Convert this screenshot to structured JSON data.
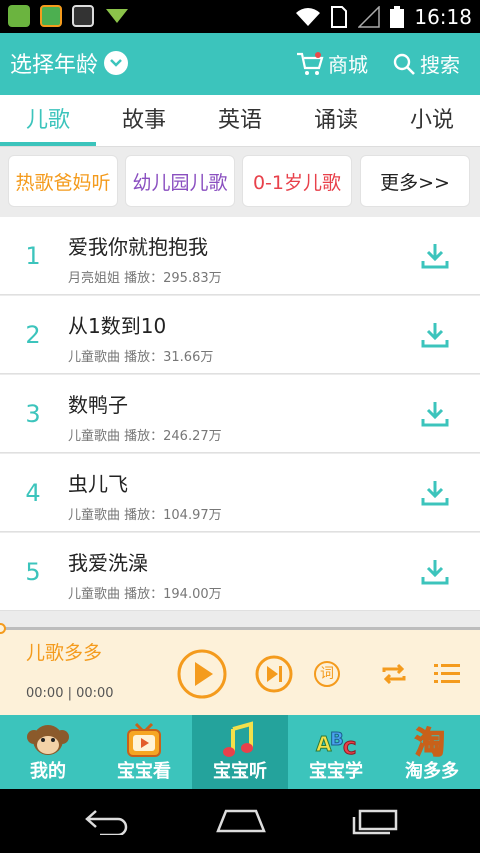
{
  "status_bar": {
    "time": "16:18"
  },
  "header": {
    "age_title": "选择年龄",
    "shop_label": "商城",
    "search_label": "搜索"
  },
  "tabs": [
    {
      "label": "儿歌",
      "active": true
    },
    {
      "label": "故事",
      "active": false
    },
    {
      "label": "英语",
      "active": false
    },
    {
      "label": "诵读",
      "active": false
    },
    {
      "label": "小说",
      "active": false
    }
  ],
  "chips": [
    "热歌爸妈听",
    "幼儿园儿歌",
    "0-1岁儿歌",
    "更多>>"
  ],
  "songs": [
    {
      "num": "1",
      "title": "爱我你就抱抱我",
      "meta": "月亮姐姐  播放：295.83万"
    },
    {
      "num": "2",
      "title": "从1数到10",
      "meta": "儿童歌曲  播放：31.66万"
    },
    {
      "num": "3",
      "title": "数鸭子",
      "meta": "儿童歌曲  播放：246.27万"
    },
    {
      "num": "4",
      "title": "虫儿飞",
      "meta": "儿童歌曲  播放：104.97万"
    },
    {
      "num": "5",
      "title": "我爱洗澡",
      "meta": "儿童歌曲  播放：194.00万"
    }
  ],
  "player": {
    "title": "儿歌多多",
    "time": "00:00 | 00:00",
    "lyrics_glyph": "词"
  },
  "bottom_nav": [
    {
      "label": "我的",
      "icon": "monkey-icon"
    },
    {
      "label": "宝宝看",
      "icon": "tv-icon"
    },
    {
      "label": "宝宝听",
      "icon": "music-note-icon",
      "active": true
    },
    {
      "label": "宝宝学",
      "icon": "abc-icon"
    },
    {
      "label": "淘多多",
      "icon": "tao-icon",
      "glyph": "淘"
    }
  ],
  "colors": {
    "accent": "#3cc4bc",
    "player_accent": "#f49b1d",
    "player_bg": "#fdf1d9"
  }
}
